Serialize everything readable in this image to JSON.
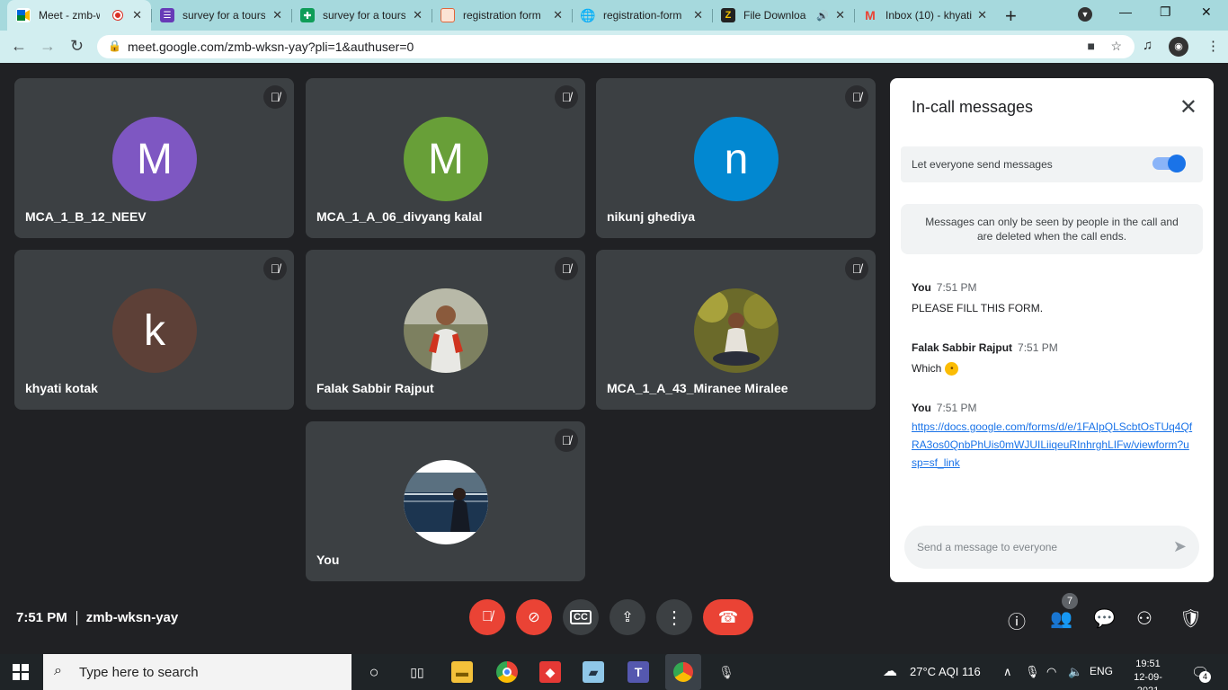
{
  "browser": {
    "tabs": [
      {
        "title": "Meet - zmb-wksn-yay",
        "icon": "google-meet-icon",
        "recording": true,
        "active": true
      },
      {
        "title": "survey for a tours",
        "icon": "google-forms-icon"
      },
      {
        "title": "survey for a tours",
        "icon": "google-sheets-icon"
      },
      {
        "title": "registration form",
        "icon": "form-page-icon"
      },
      {
        "title": "registration-form",
        "icon": "globe-icon"
      },
      {
        "title": "File Download",
        "icon": "download-site-icon",
        "audio": true
      },
      {
        "title": "Inbox (10) - khyati",
        "icon": "gmail-icon"
      }
    ],
    "url": "meet.google.com/zmb-wksn-yay?pli=1&authuser=0"
  },
  "participants": [
    {
      "name": "MCA_1_B_12_NEEV",
      "initial": "M",
      "color": "#7e57c2"
    },
    {
      "name": "MCA_1_A_06_divyang kalal",
      "initial": "M",
      "color": "#689f38"
    },
    {
      "name": "nikunj ghediya",
      "initial": "n",
      "color": "#0288d1"
    },
    {
      "name": "khyati kotak",
      "initial": "k",
      "color": "#5d4037"
    },
    {
      "name": "Falak Sabbir Rajput",
      "initial": "",
      "color": "#8d8d7a"
    },
    {
      "name": "MCA_1_A_43_Miranee Miralee",
      "initial": "",
      "color": "#6b6a2a"
    },
    {
      "name": "You",
      "initial": "",
      "color": "#17304a"
    }
  ],
  "chat": {
    "title": "In-call messages",
    "toggle_label": "Let everyone send messages",
    "toggle_on": true,
    "notice": "Messages can only be seen by people in the call and are deleted when the call ends.",
    "messages": [
      {
        "sender": "You",
        "time": "7:51 PM",
        "text": "PLEASE FILL THIS FORM."
      },
      {
        "sender": "Falak Sabbir Rajput",
        "time": "7:51 PM",
        "text": "Which"
      },
      {
        "sender": "You",
        "time": "7:51 PM",
        "text": "https://docs.google.com/forms/d/e/1FAIpQLScbtOsTUq4QfRA3os0QnbPhUis0mWJUILiiqeuRInhrghLIFw/viewform?usp=sf_link"
      }
    ],
    "input_placeholder": "Send a message to everyone"
  },
  "meeting": {
    "time": "7:51 PM",
    "code": "zmb-wksn-yay",
    "participant_count": "7"
  },
  "taskbar": {
    "search_placeholder": "Type here to search",
    "weather": "27°C  AQI 116",
    "lang": "ENG",
    "time": "19:51",
    "date": "12-09-2021",
    "notifications": "4"
  },
  "colors": {
    "accent": "#1a73e8",
    "danger": "#ea4335",
    "tile_bg": "#3c4043",
    "page_bg": "#202124"
  }
}
